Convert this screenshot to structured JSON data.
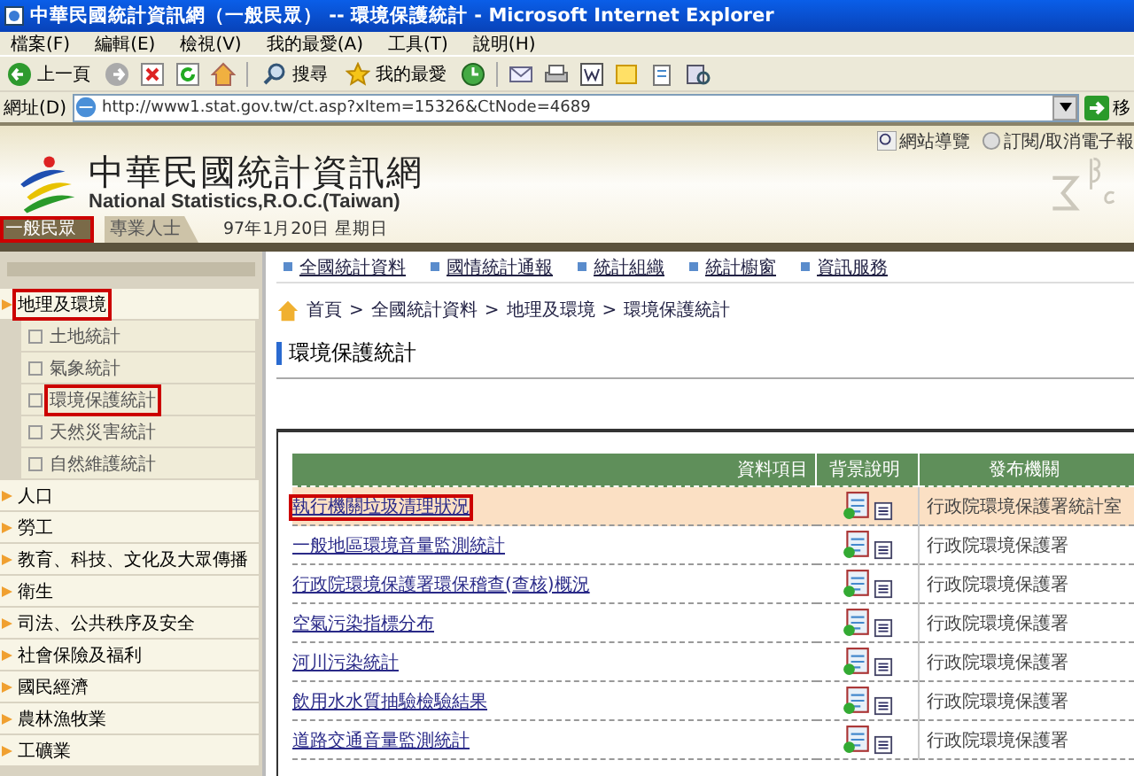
{
  "window": {
    "title": "中華民國統計資訊網（一般民眾） -- 環境保護統計 - Microsoft Internet Explorer"
  },
  "menu": [
    "檔案(F)",
    "編輯(E)",
    "檢視(V)",
    "我的最愛(A)",
    "工具(T)",
    "說明(H)"
  ],
  "toolbar": {
    "back": "上一頁",
    "search": "搜尋",
    "favorites": "我的最愛"
  },
  "address": {
    "label": "網址(D)",
    "url": "http://www1.stat.gov.tw/ct.asp?xItem=15326&CtNode=4689",
    "go": "移"
  },
  "site": {
    "links": [
      "網站導覽",
      "訂閱/取消電子報"
    ],
    "title": "中華民國統計資訊網",
    "subtitle": "National Statistics,R.O.C.(Taiwan)",
    "tabs": [
      {
        "label": "一般民眾",
        "selected": true,
        "highlighted": true
      },
      {
        "label": "專業人士",
        "selected": false,
        "highlighted": false
      }
    ],
    "date": "97年1月20日 星期日"
  },
  "sidebar": {
    "items": [
      {
        "label": "地理及環境",
        "highlighted": true,
        "children": [
          {
            "label": "土地統計",
            "highlighted": false
          },
          {
            "label": "氣象統計",
            "highlighted": false
          },
          {
            "label": "環境保護統計",
            "highlighted": true
          },
          {
            "label": "天然災害統計",
            "highlighted": false
          },
          {
            "label": "自然維護統計",
            "highlighted": false
          }
        ]
      },
      {
        "label": "人口",
        "highlighted": false
      },
      {
        "label": "勞工",
        "highlighted": false
      },
      {
        "label": "教育、科技、文化及大眾傳播",
        "highlighted": false
      },
      {
        "label": "衛生",
        "highlighted": false
      },
      {
        "label": "司法、公共秩序及安全",
        "highlighted": false
      },
      {
        "label": "社會保險及福利",
        "highlighted": false
      },
      {
        "label": "國民經濟",
        "highlighted": false
      },
      {
        "label": "農林漁牧業",
        "highlighted": false
      },
      {
        "label": "工礦業",
        "highlighted": false
      }
    ]
  },
  "nav": [
    "全國統計資料",
    "國情統計通報",
    "統計組織",
    "統計櫥窗",
    "資訊服務"
  ],
  "breadcrumb": {
    "separator": ">",
    "items": [
      "首頁",
      "全國統計資料",
      "地理及環境",
      "環境保護統計"
    ]
  },
  "heading": "環境保護統計",
  "table": {
    "columns": [
      "資料項目",
      "背景說明",
      "發布機關"
    ],
    "rows": [
      {
        "item": "執行機關垃圾清理狀況",
        "org": "行政院環境保護署統計室",
        "selected": true,
        "highlighted": true
      },
      {
        "item": "一般地區環境音量監測統計",
        "org": "行政院環境保護署",
        "selected": false,
        "highlighted": false
      },
      {
        "item": "行政院環境保護署環保稽查(查核)概況",
        "org": "行政院環境保護署",
        "selected": false,
        "highlighted": false
      },
      {
        "item": "空氣污染指標分布",
        "org": "行政院環境保護署",
        "selected": false,
        "highlighted": false
      },
      {
        "item": "河川污染統計",
        "org": "行政院環境保護署",
        "selected": false,
        "highlighted": false
      },
      {
        "item": "飲用水水質抽驗檢驗結果",
        "org": "行政院環境保護署",
        "selected": false,
        "highlighted": false
      },
      {
        "item": "道路交通音量監測統計",
        "org": "行政院環境保護署",
        "selected": false,
        "highlighted": false
      }
    ]
  }
}
